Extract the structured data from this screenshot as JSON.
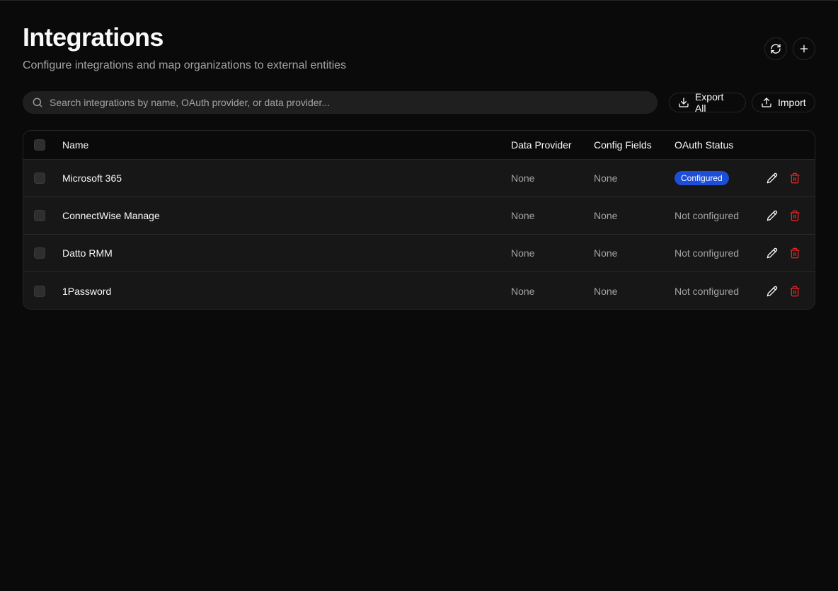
{
  "header": {
    "title": "Integrations",
    "subtitle": "Configure integrations and map organizations to external entities",
    "refresh_icon": "refresh-icon",
    "add_icon": "plus-icon"
  },
  "toolbar": {
    "search_placeholder": "Search integrations by name, OAuth provider, or data provider...",
    "search_value": "",
    "export_label": "Export All",
    "import_label": "Import"
  },
  "table": {
    "columns": {
      "name": "Name",
      "data_provider": "Data Provider",
      "config_fields": "Config Fields",
      "oauth_status": "OAuth Status"
    },
    "rows": [
      {
        "name": "Microsoft 365",
        "data_provider": "None",
        "config_fields": "None",
        "oauth_status": "Configured",
        "oauth_configured": true
      },
      {
        "name": "ConnectWise Manage",
        "data_provider": "None",
        "config_fields": "None",
        "oauth_status": "Not configured",
        "oauth_configured": false
      },
      {
        "name": "Datto RMM",
        "data_provider": "None",
        "config_fields": "None",
        "oauth_status": "Not configured",
        "oauth_configured": false
      },
      {
        "name": "1Password",
        "data_provider": "None",
        "config_fields": "None",
        "oauth_status": "Not configured",
        "oauth_configured": false
      }
    ]
  },
  "colors": {
    "background": "#0a0a0a",
    "row_background": "#171717",
    "badge": "#1d4ed8",
    "delete": "#dc2626"
  }
}
